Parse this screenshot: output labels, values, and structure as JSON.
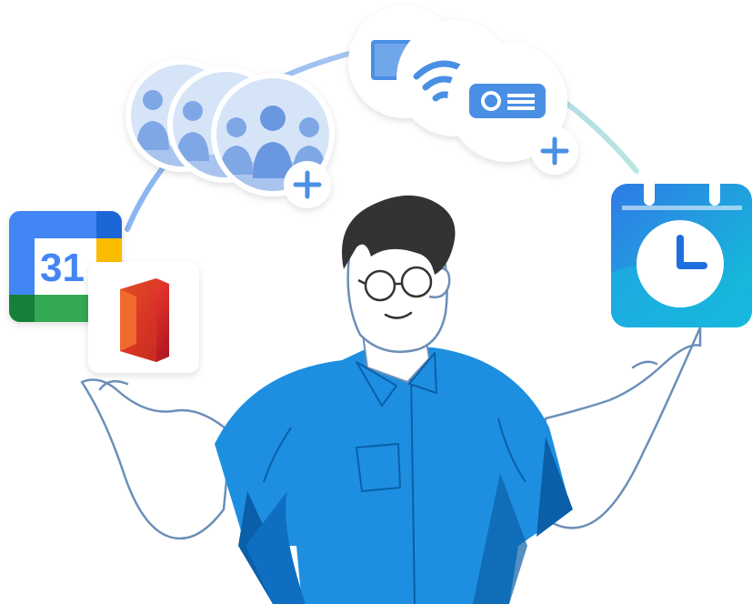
{
  "icons": {
    "people_group": "people-group-icon",
    "equipment_group": "equipment-icon",
    "google_calendar": "google-calendar-icon",
    "office": "microsoft-office-icon",
    "reminder_calendar": "calendar-clock-icon"
  },
  "google_calendar": {
    "day": "31"
  },
  "colors": {
    "shirt": "#1E8FE0",
    "shirt_shadow": "#0A5FA8",
    "hair": "#333333",
    "skin": "#ffffff",
    "arc_start": "#8AB4F0",
    "arc_end": "#B8E6E0",
    "accent_blue": "#4A8FE4",
    "calendar_teal": "#0FC8D8"
  }
}
